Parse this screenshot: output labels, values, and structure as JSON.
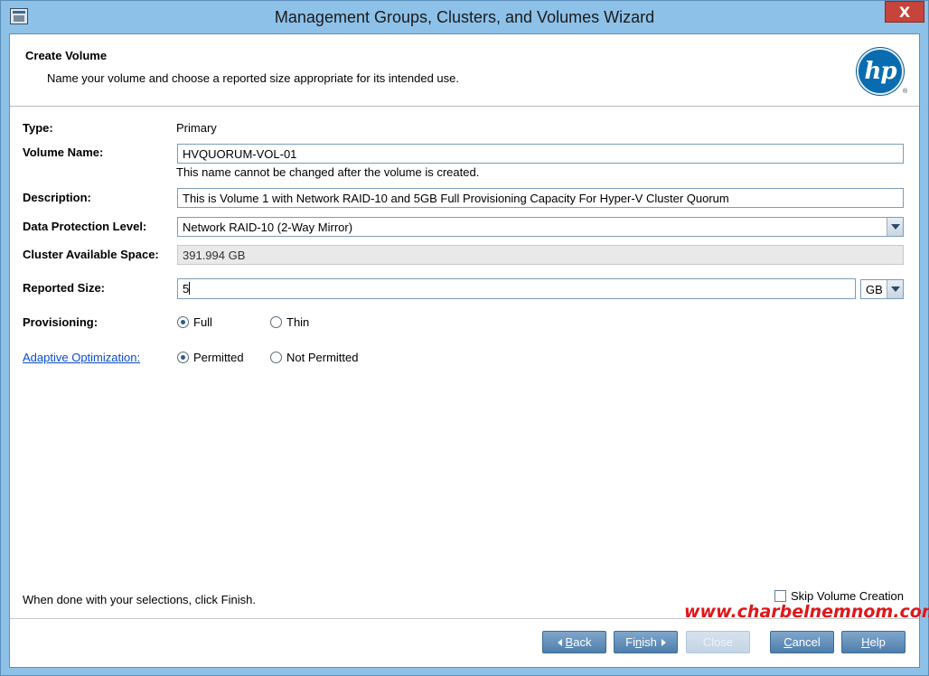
{
  "window": {
    "title": "Management Groups, Clusters, and Volumes Wizard",
    "close_glyph": "X"
  },
  "header": {
    "title": "Create Volume",
    "subtitle": "Name your volume and choose a reported size appropriate for its intended use.",
    "logo_text": "hp",
    "logo_mark": "®"
  },
  "form": {
    "type": {
      "label": "Type:",
      "value": "Primary"
    },
    "volume_name": {
      "label": "Volume Name:",
      "value": "HVQUORUM-VOL-01",
      "help": "This name cannot be changed after the volume is created."
    },
    "description": {
      "label": "Description:",
      "value": "This is Volume 1 with Network RAID-10 and 5GB Full Provisioning Capacity For Hyper-V Cluster Quorum"
    },
    "data_protection": {
      "label": "Data Protection Level:",
      "value": "Network RAID-10 (2-Way Mirror)"
    },
    "cluster_space": {
      "label": "Cluster Available Space:",
      "value": "391.994 GB"
    },
    "reported_size": {
      "label": "Reported Size:",
      "value": "5",
      "unit": "GB"
    },
    "provisioning": {
      "label": "Provisioning:",
      "options": [
        "Full",
        "Thin"
      ],
      "selected": "Full"
    },
    "adaptive_optimization": {
      "label": "Adaptive Optimization:",
      "options": [
        "Permitted",
        "Not Permitted"
      ],
      "selected": "Permitted"
    }
  },
  "footer": {
    "note": "When done with your selections, click Finish.",
    "skip_label": "Skip Volume Creation",
    "skip_checked": false,
    "watermark": "www.charbelnemnom.com"
  },
  "buttons": {
    "back": {
      "pre": "",
      "mnemonic": "B",
      "post": "ack"
    },
    "finish": {
      "pre": "Fi",
      "mnemonic": "n",
      "post": "ish"
    },
    "close": {
      "label": "Close",
      "enabled": false
    },
    "cancel": {
      "pre": "",
      "mnemonic": "C",
      "post": "ancel"
    },
    "help": {
      "pre": "",
      "mnemonic": "H",
      "post": "elp"
    }
  },
  "colors": {
    "titlebar": "#8ec1e8",
    "close": "#c7443a",
    "button": "#4f7eab",
    "link": "#0a4cc8",
    "watermark": "#e0161a",
    "hp_blue": "#0a6cb0"
  }
}
